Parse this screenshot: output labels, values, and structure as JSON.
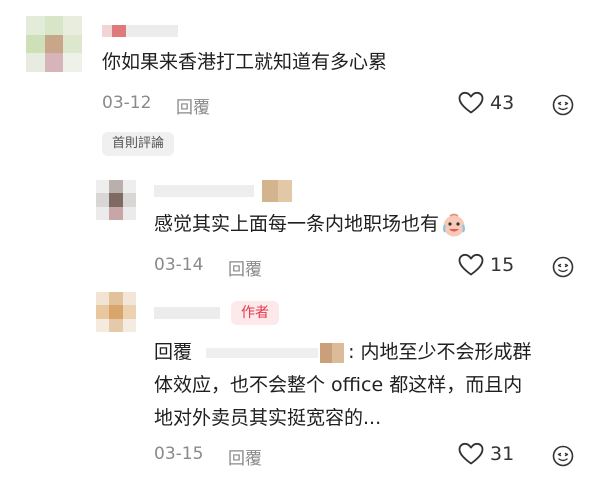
{
  "comments": [
    {
      "text": "你如果来香港打工就知道有多心累",
      "date": "03-12",
      "reply_label": "回覆",
      "likes": "43",
      "icons": {
        "like": "heart-outline-icon",
        "dislike": "tongue-face-icon"
      },
      "badge": "首則評論"
    },
    {
      "text": "感觉其实上面每一条内地职场也有",
      "emoji": "crying-laughing-baby-emoji",
      "date": "03-14",
      "reply_label": "回覆",
      "likes": "15",
      "icons": {
        "like": "heart-outline-icon",
        "dislike": "tongue-face-icon"
      }
    },
    {
      "author_badge": "作者",
      "reply_prefix": "回覆",
      "line1": ": 内地至少不会形成群",
      "line2": "体效应，也不会整个 office 都这样，而且内",
      "line3": "地对外卖员其实挺宽容的...",
      "date": "03-15",
      "reply_label": "回覆",
      "likes": "31",
      "icons": {
        "like": "heart-outline-icon",
        "dislike": "tongue-face-icon"
      }
    }
  ],
  "colors": {
    "meta_gray": "#8a8a8a",
    "author_badge_text": "#e4394f",
    "author_badge_bg": "#fde8ea"
  }
}
